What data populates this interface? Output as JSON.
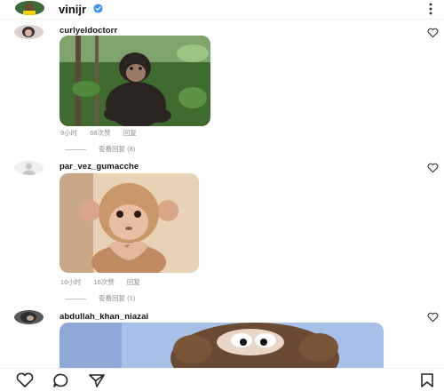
{
  "header": {
    "username": "vinijr",
    "verified_color": "#3897f0"
  },
  "comments": [
    {
      "username": "curlyeldoctorr",
      "time": "9小时",
      "likes": "68次赞",
      "reply": "回复",
      "view_replies": "查看回复 (8)",
      "image_subject": "chimpanzee"
    },
    {
      "username": "par_vez_gumacche",
      "time": "10小时",
      "likes": "16次赞",
      "reply": "回复",
      "view_replies": "查看回复 (1)",
      "image_subject": "baby-monkey-heart-hands"
    },
    {
      "username": "abdullah_khan_niazai",
      "image_subject": "cartoon-gorilla"
    }
  ],
  "icons": {
    "bottom_left": [
      "heart-icon",
      "comment-icon",
      "share-icon"
    ],
    "bottom_right": "bookmark-icon",
    "top_right": "more-icon"
  }
}
